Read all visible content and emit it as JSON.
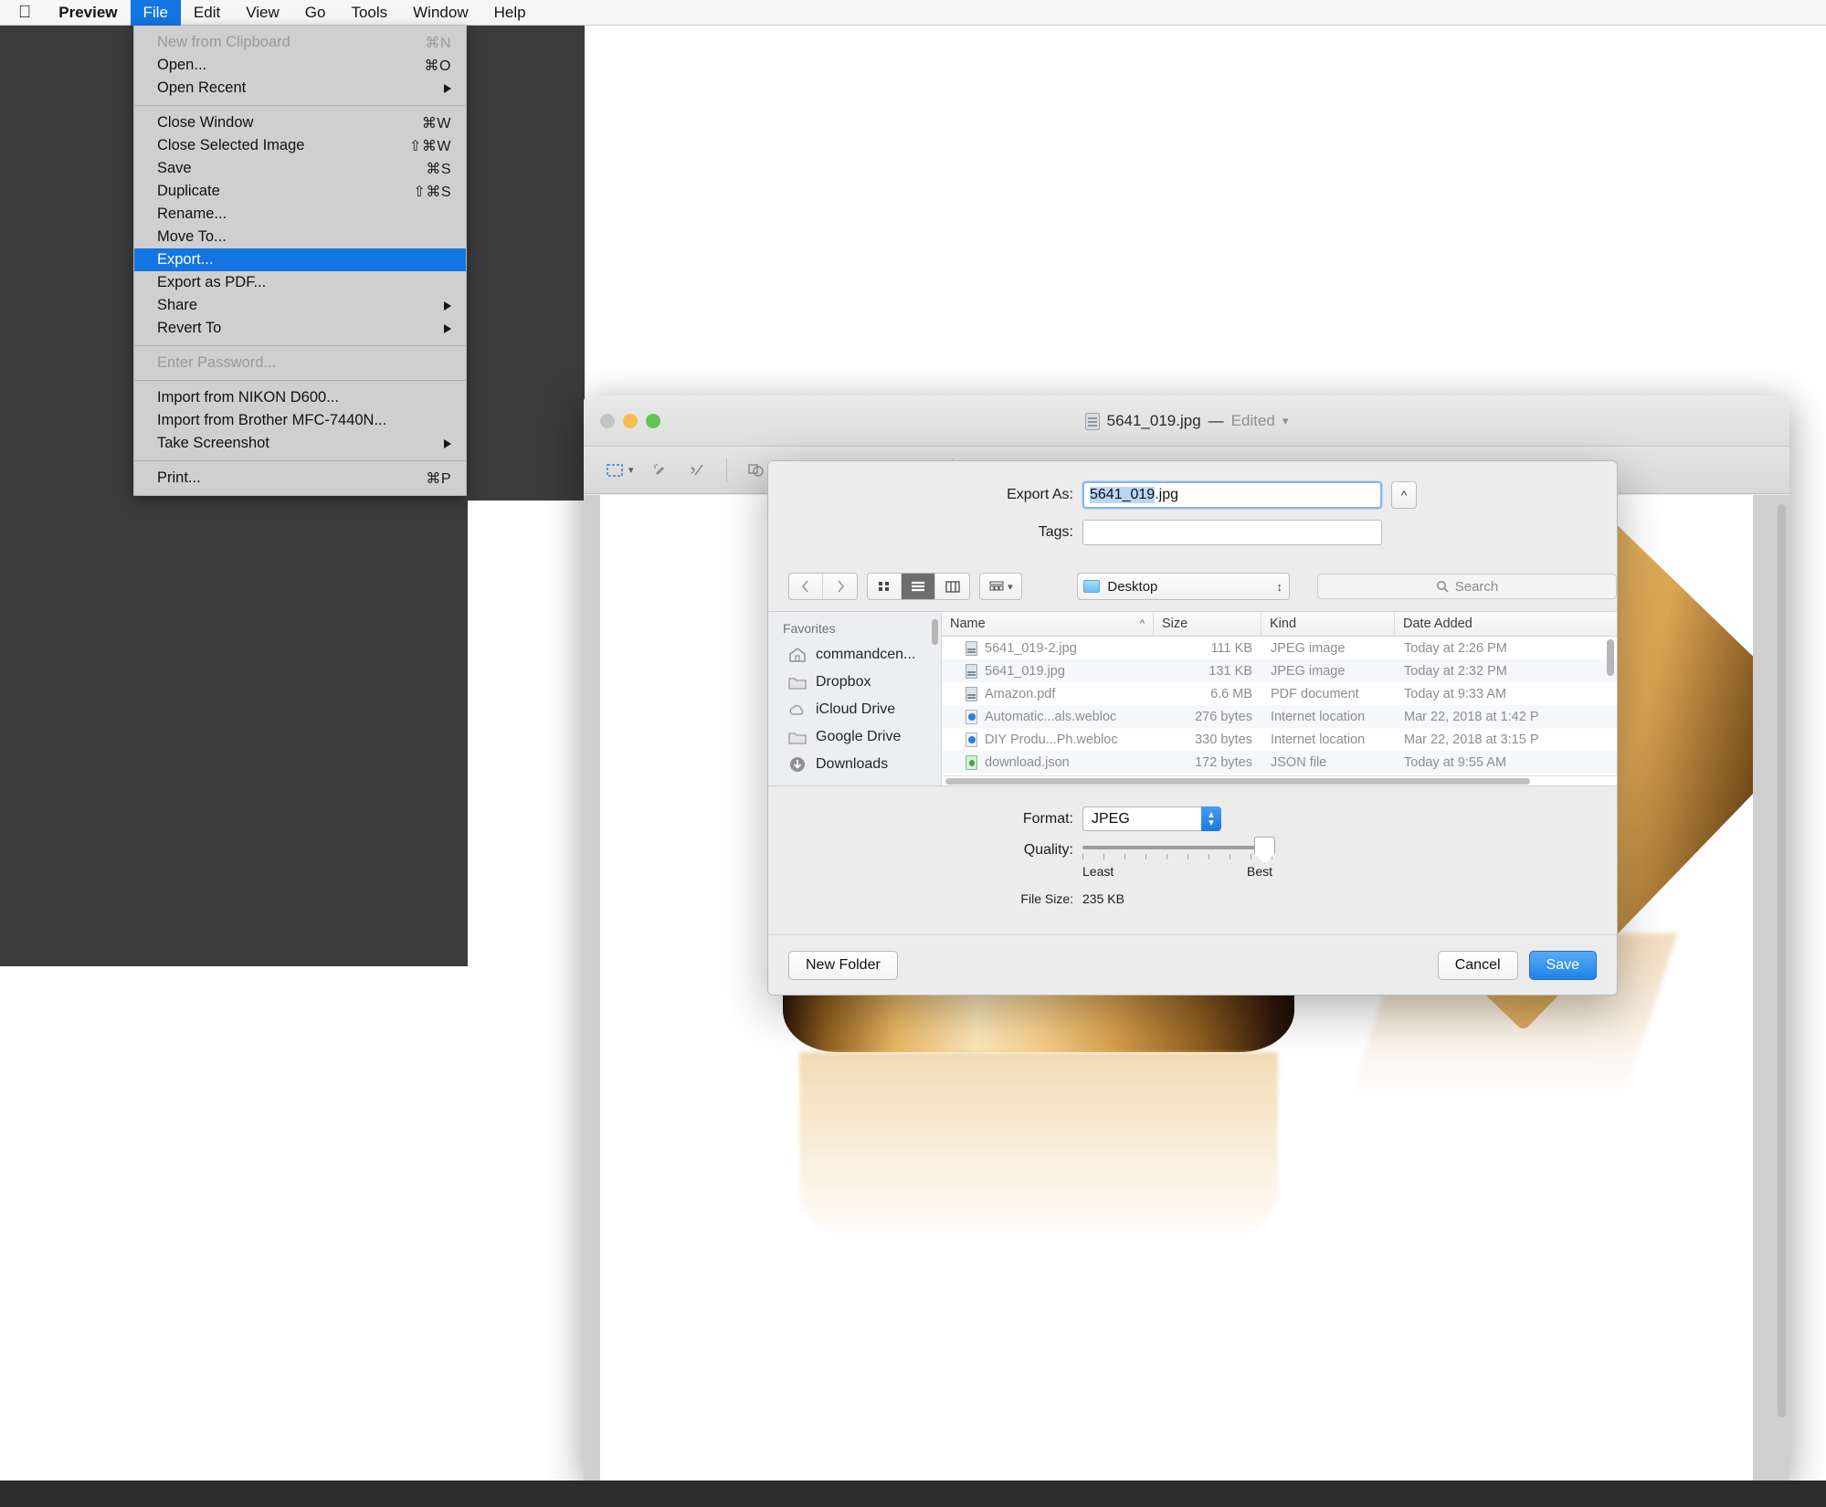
{
  "menubar": {
    "apple_icon": "apple-logo-icon",
    "items": [
      {
        "label": "Preview",
        "bold": true,
        "active": false
      },
      {
        "label": "File",
        "bold": false,
        "active": true
      },
      {
        "label": "Edit",
        "bold": false,
        "active": false
      },
      {
        "label": "View",
        "bold": false,
        "active": false
      },
      {
        "label": "Go",
        "bold": false,
        "active": false
      },
      {
        "label": "Tools",
        "bold": false,
        "active": false
      },
      {
        "label": "Window",
        "bold": false,
        "active": false
      },
      {
        "label": "Help",
        "bold": false,
        "active": false
      }
    ]
  },
  "file_menu": {
    "groups": [
      [
        {
          "label": "New from Clipboard",
          "shortcut": "⌘N",
          "disabled": true,
          "submenu": false,
          "selected": false
        },
        {
          "label": "Open...",
          "shortcut": "⌘O",
          "disabled": false,
          "submenu": false,
          "selected": false
        },
        {
          "label": "Open Recent",
          "shortcut": "",
          "disabled": false,
          "submenu": true,
          "selected": false
        }
      ],
      [
        {
          "label": "Close Window",
          "shortcut": "⌘W",
          "disabled": false,
          "submenu": false,
          "selected": false
        },
        {
          "label": "Close Selected Image",
          "shortcut": "⇧⌘W",
          "disabled": false,
          "submenu": false,
          "selected": false
        },
        {
          "label": "Save",
          "shortcut": "⌘S",
          "disabled": false,
          "submenu": false,
          "selected": false
        },
        {
          "label": "Duplicate",
          "shortcut": "⇧⌘S",
          "disabled": false,
          "submenu": false,
          "selected": false
        },
        {
          "label": "Rename...",
          "shortcut": "",
          "disabled": false,
          "submenu": false,
          "selected": false
        },
        {
          "label": "Move To...",
          "shortcut": "",
          "disabled": false,
          "submenu": false,
          "selected": false
        },
        {
          "label": "Export...",
          "shortcut": "",
          "disabled": false,
          "submenu": false,
          "selected": true
        },
        {
          "label": "Export as PDF...",
          "shortcut": "",
          "disabled": false,
          "submenu": false,
          "selected": false
        },
        {
          "label": "Share",
          "shortcut": "",
          "disabled": false,
          "submenu": true,
          "selected": false
        },
        {
          "label": "Revert To",
          "shortcut": "",
          "disabled": false,
          "submenu": true,
          "selected": false
        }
      ],
      [
        {
          "label": "Enter Password...",
          "shortcut": "",
          "disabled": true,
          "submenu": false,
          "selected": false
        }
      ],
      [
        {
          "label": "Import from NIKON D600...",
          "shortcut": "",
          "disabled": false,
          "submenu": false,
          "selected": false
        },
        {
          "label": "Import from Brother MFC-7440N...",
          "shortcut": "",
          "disabled": false,
          "submenu": false,
          "selected": false
        },
        {
          "label": "Take Screenshot",
          "shortcut": "",
          "disabled": false,
          "submenu": true,
          "selected": false
        }
      ],
      [
        {
          "label": "Print...",
          "shortcut": "⌘P",
          "disabled": false,
          "submenu": false,
          "selected": false
        }
      ]
    ]
  },
  "window": {
    "title": "5641_019.jpg",
    "title_separator": "—",
    "edited_label": "Edited",
    "toolbar_icons": [
      "rectangular-selection-icon",
      "instant-alpha-icon",
      "sketch-icon",
      "shapes-icon",
      "text-icon",
      "signature-icon",
      "adjust-color-icon",
      "adjust-size-icon",
      "text-style-icon",
      "shape-style-icon",
      "border-style-icon",
      "font-icon"
    ]
  },
  "sheet": {
    "export_as_label": "Export As:",
    "export_as_value_selected": "5641_019",
    "export_as_value_rest": ".jpg",
    "name_expand_icon": "chevron-up-icon",
    "tags_label": "Tags:",
    "tags_value": "",
    "nav": {
      "back_icon": "chevron-left-icon",
      "forward_icon": "chevron-right-icon",
      "view_icons": [
        "icon-view-icon",
        "list-view-icon",
        "column-view-icon"
      ],
      "group_icon": "group-by-icon",
      "group_chevron": "chevron-down-icon",
      "path_icon": "folder-icon",
      "path_value": "Desktop",
      "path_stepper_icon": "up-down-chevron-icon",
      "search_icon": "search-icon",
      "search_placeholder": "Search"
    },
    "sidebar": {
      "header": "Favorites",
      "items": [
        {
          "label": "commandcen...",
          "icon": "home-icon"
        },
        {
          "label": "Dropbox",
          "icon": "folder-icon"
        },
        {
          "label": "iCloud Drive",
          "icon": "cloud-icon"
        },
        {
          "label": "Google Drive",
          "icon": "folder-icon"
        },
        {
          "label": "Downloads",
          "icon": "downloads-icon"
        }
      ]
    },
    "columns": [
      {
        "label": "Name",
        "sort_icon": "chevron-up-icon"
      },
      {
        "label": "Size"
      },
      {
        "label": "Kind"
      },
      {
        "label": "Date Added"
      }
    ],
    "files": [
      {
        "name": "5641_019-2.jpg",
        "size": "111 KB",
        "kind": "JPEG image",
        "date": "Today at 2:26 PM",
        "icon": "jpg"
      },
      {
        "name": "5641_019.jpg",
        "size": "131 KB",
        "kind": "JPEG image",
        "date": "Today at 2:32 PM",
        "icon": "jpg"
      },
      {
        "name": "Amazon.pdf",
        "size": "6.6 MB",
        "kind": "PDF document",
        "date": "Today at 9:33 AM",
        "icon": "pdf"
      },
      {
        "name": "Automatic...als.webloc",
        "size": "276 bytes",
        "kind": "Internet location",
        "date": "Mar 22, 2018 at 1:42 P",
        "icon": "web"
      },
      {
        "name": "DIY Produ...Ph.webloc",
        "size": "330 bytes",
        "kind": "Internet location",
        "date": "Mar 22, 2018 at 3:15 P",
        "icon": "web"
      },
      {
        "name": "download.json",
        "size": "172 bytes",
        "kind": "JSON file",
        "date": "Today at 9:55 AM",
        "icon": "json"
      }
    ],
    "format_label": "Format:",
    "format_value": "JPEG",
    "quality_label": "Quality:",
    "quality_least": "Least",
    "quality_best": "Best",
    "quality_percent": 90,
    "file_size_label": "File Size:",
    "file_size_value": "235 KB",
    "new_folder_label": "New Folder",
    "cancel_label": "Cancel",
    "save_label": "Save"
  },
  "colors": {
    "accent": "#1375e2",
    "menu_bg": "#cfcfcf",
    "sheet_bg": "#ececec"
  }
}
